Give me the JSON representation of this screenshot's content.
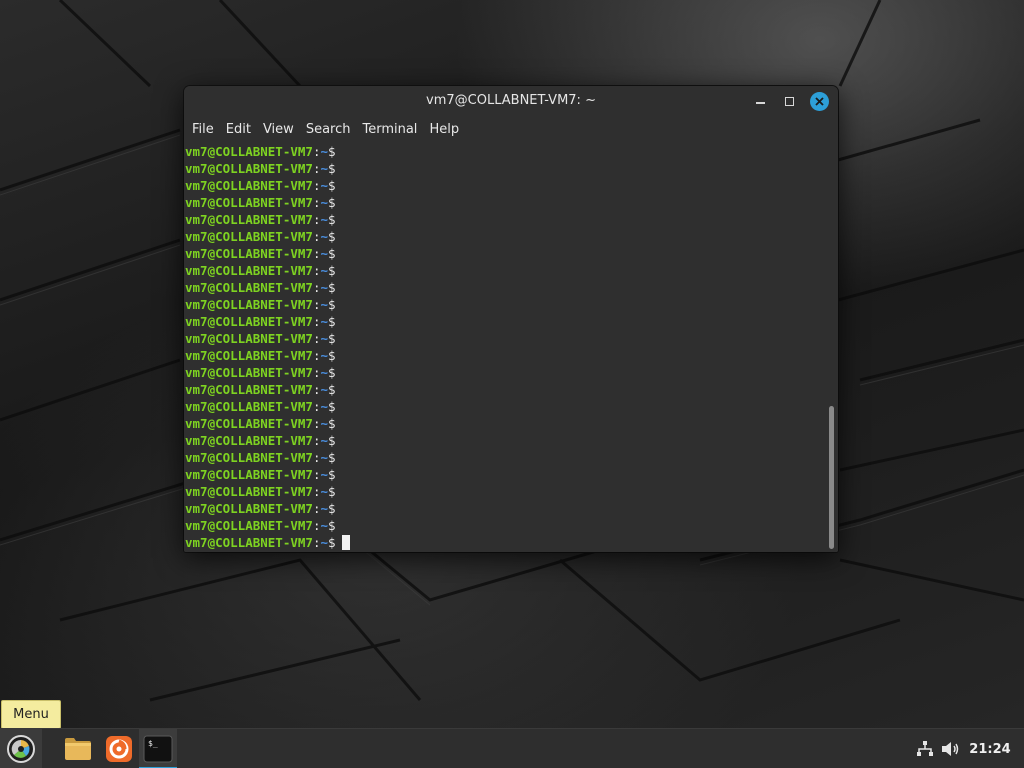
{
  "window": {
    "title": "vm7@COLLABNET-VM7: ~",
    "menu": [
      "File",
      "Edit",
      "View",
      "Search",
      "Terminal",
      "Help"
    ]
  },
  "terminal": {
    "user_host": "vm7@COLLABNET-VM7",
    "separator": ":",
    "path": "~",
    "prompt_symbol": "$",
    "line_count": 24
  },
  "tooltip": {
    "label": "Menu"
  },
  "taskbar": {
    "clock": "21:24",
    "apps": [
      {
        "icon": "linux-mint-menu-icon"
      },
      {
        "icon": "files-folder-icon"
      },
      {
        "icon": "firefox-icon"
      },
      {
        "icon": "terminal-icon"
      }
    ],
    "tray": [
      {
        "icon": "network-icon"
      },
      {
        "icon": "volume-icon"
      }
    ]
  },
  "colors": {
    "prompt_user": "#7ed321",
    "prompt_path": "#4a8fe0",
    "accent": "#2d9fd8",
    "tooltip_bg": "#f4ec9f"
  }
}
